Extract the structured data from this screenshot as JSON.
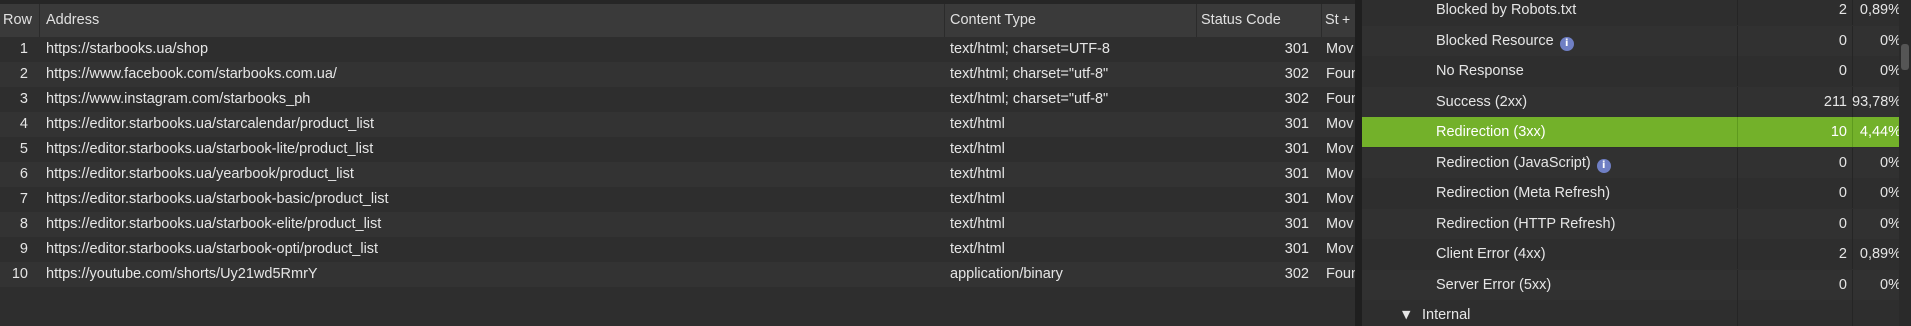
{
  "table": {
    "headers": {
      "row": "Row",
      "address": "Address",
      "content_type": "Content Type",
      "status_code": "Status Code",
      "status": "St"
    },
    "rows": [
      {
        "row": "1",
        "address": "https://starbooks.ua/shop",
        "content_type": "text/html; charset=UTF-8",
        "status_code": "301",
        "status": "Mov"
      },
      {
        "row": "2",
        "address": "https://www.facebook.com/starbooks.com.ua/",
        "content_type": "text/html; charset=\"utf-8\"",
        "status_code": "302",
        "status": "Foun"
      },
      {
        "row": "3",
        "address": "https://www.instagram.com/starbooks_ph",
        "content_type": "text/html; charset=\"utf-8\"",
        "status_code": "302",
        "status": "Foun"
      },
      {
        "row": "4",
        "address": "https://editor.starbooks.ua/starcalendar/product_list",
        "content_type": "text/html",
        "status_code": "301",
        "status": "Mov"
      },
      {
        "row": "5",
        "address": "https://editor.starbooks.ua/starbook-lite/product_list",
        "content_type": "text/html",
        "status_code": "301",
        "status": "Mov"
      },
      {
        "row": "6",
        "address": "https://editor.starbooks.ua/yearbook/product_list",
        "content_type": "text/html",
        "status_code": "301",
        "status": "Mov"
      },
      {
        "row": "7",
        "address": "https://editor.starbooks.ua/starbook-basic/product_list",
        "content_type": "text/html",
        "status_code": "301",
        "status": "Mov"
      },
      {
        "row": "8",
        "address": "https://editor.starbooks.ua/starbook-elite/product_list",
        "content_type": "text/html",
        "status_code": "301",
        "status": "Mov"
      },
      {
        "row": "9",
        "address": "https://editor.starbooks.ua/starbook-opti/product_list",
        "content_type": "text/html",
        "status_code": "301",
        "status": "Mov"
      },
      {
        "row": "10",
        "address": "https://youtube.com/shorts/Uy21wd5RmrY",
        "content_type": "application/binary",
        "status_code": "302",
        "status": "Foun"
      }
    ]
  },
  "overview": {
    "rows": [
      {
        "label": "Blocked by Robots.txt",
        "count": "2",
        "pct": "0,89%",
        "info": false
      },
      {
        "label": "Blocked Resource",
        "count": "0",
        "pct": "0%",
        "info": true
      },
      {
        "label": "No Response",
        "count": "0",
        "pct": "0%",
        "info": false
      },
      {
        "label": "Success (2xx)",
        "count": "211",
        "pct": "93,78%",
        "info": false
      },
      {
        "label": "Redirection (3xx)",
        "count": "10",
        "pct": "4,44%",
        "info": false,
        "selected": true
      },
      {
        "label": "Redirection (JavaScript)",
        "count": "0",
        "pct": "0%",
        "info": true
      },
      {
        "label": "Redirection (Meta Refresh)",
        "count": "0",
        "pct": "0%",
        "info": false
      },
      {
        "label": "Redirection (HTTP Refresh)",
        "count": "0",
        "pct": "0%",
        "info": false
      },
      {
        "label": "Client Error (4xx)",
        "count": "2",
        "pct": "0,89%",
        "info": false
      },
      {
        "label": "Server Error (5xx)",
        "count": "0",
        "pct": "0%",
        "info": false
      }
    ],
    "section": {
      "label": "Internal",
      "icon": "triangle-down-icon"
    },
    "info_glyph": "i",
    "selected_color": "#73b12a"
  },
  "icons": {
    "sort_plus": "+",
    "triangle": "▼"
  }
}
